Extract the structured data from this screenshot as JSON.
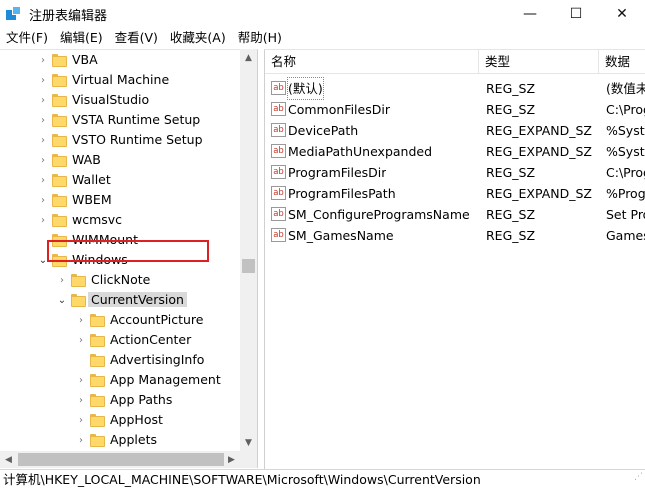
{
  "window": {
    "title": "注册表编辑器",
    "controls": {
      "minimize": "—",
      "maximize": "☐",
      "close": "✕"
    }
  },
  "menu": [
    "文件(F)",
    "编辑(E)",
    "查看(V)",
    "收藏夹(A)",
    "帮助(H)"
  ],
  "tree": {
    "items": [
      {
        "label": "VBA",
        "expander": "›"
      },
      {
        "label": "Virtual Machine",
        "expander": "›"
      },
      {
        "label": "VisualStudio",
        "expander": "›"
      },
      {
        "label": "VSTA Runtime Setup",
        "expander": "›"
      },
      {
        "label": "VSTO Runtime Setup",
        "expander": "›"
      },
      {
        "label": "WAB",
        "expander": "›"
      },
      {
        "label": "Wallet",
        "expander": "›"
      },
      {
        "label": "WBEM",
        "expander": "›"
      },
      {
        "label": "wcmsvc",
        "expander": "›"
      },
      {
        "label": "WIMMount",
        "expander": ""
      },
      {
        "label": "Windows",
        "expander": "⌄"
      },
      {
        "label": "ClickNote",
        "expander": "›"
      },
      {
        "label": "CurrentVersion",
        "expander": "⌄"
      },
      {
        "label": "AccountPicture",
        "expander": "›"
      },
      {
        "label": "ActionCenter",
        "expander": "›"
      },
      {
        "label": "AdvertisingInfo",
        "expander": ""
      },
      {
        "label": "App Management",
        "expander": "›"
      },
      {
        "label": "App Paths",
        "expander": "›"
      },
      {
        "label": "AppHost",
        "expander": "›"
      },
      {
        "label": "Applets",
        "expander": "›"
      }
    ],
    "selected": "CurrentVersion"
  },
  "list": {
    "headers": {
      "name": "名称",
      "type": "类型",
      "data": "数据"
    },
    "rows": [
      {
        "name": "(默认)",
        "type": "REG_SZ",
        "data": "(数值未"
      },
      {
        "name": "CommonFilesDir",
        "type": "REG_SZ",
        "data": "C:\\Prog"
      },
      {
        "name": "DevicePath",
        "type": "REG_EXPAND_SZ",
        "data": "%Syste"
      },
      {
        "name": "MediaPathUnexpanded",
        "type": "REG_EXPAND_SZ",
        "data": "%Syste"
      },
      {
        "name": "ProgramFilesDir",
        "type": "REG_SZ",
        "data": "C:\\Prog"
      },
      {
        "name": "ProgramFilesPath",
        "type": "REG_EXPAND_SZ",
        "data": "%Prog"
      },
      {
        "name": "SM_ConfigureProgramsName",
        "type": "REG_SZ",
        "data": "Set Pro"
      },
      {
        "name": "SM_GamesName",
        "type": "REG_SZ",
        "data": "Games"
      }
    ],
    "value_icon": "ab"
  },
  "status": {
    "path": "计算机\\HKEY_LOCAL_MACHINE\\SOFTWARE\\Microsoft\\Windows\\CurrentVersion"
  },
  "colors": {
    "highlight_box": "#e02020",
    "folder": "#ffd86a",
    "selection": "#d9d9d9"
  }
}
